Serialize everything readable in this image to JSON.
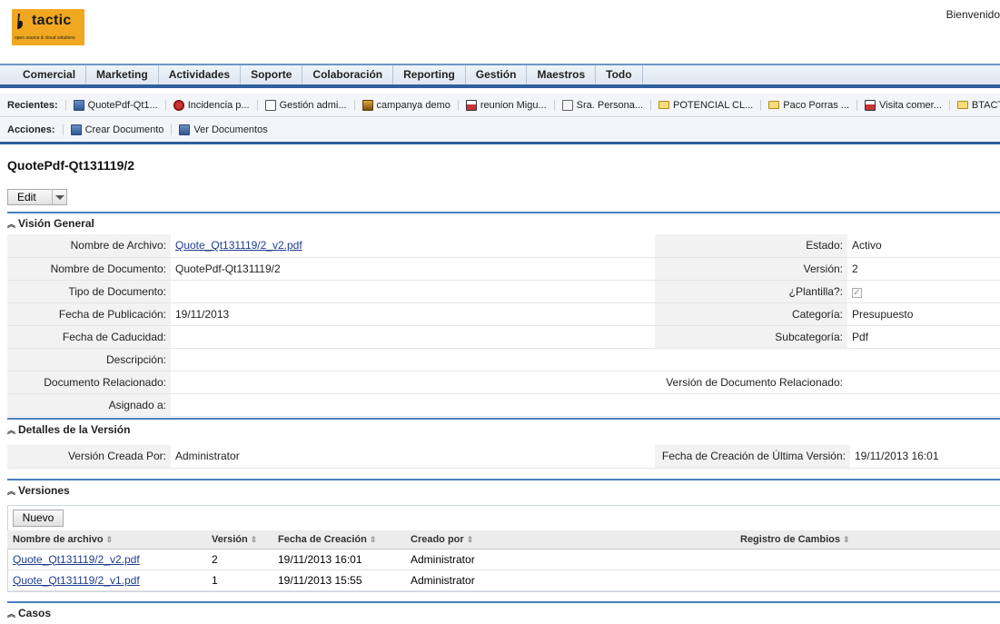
{
  "brand": {
    "name": "tactic",
    "tagline": "open source & cloud solutions",
    "accent": "#f0a820"
  },
  "header": {
    "welcome": "Bienvenido"
  },
  "nav": {
    "items": [
      "Comercial",
      "Marketing",
      "Actividades",
      "Soporte",
      "Colaboración",
      "Reporting",
      "Gestión",
      "Maestros",
      "Todo"
    ]
  },
  "recent": {
    "label": "Recientes:",
    "items": [
      {
        "label": "QuotePdf-Qt1...",
        "icon": "document-icon"
      },
      {
        "label": "Incidencia p...",
        "icon": "bug-icon"
      },
      {
        "label": "Gestión admi...",
        "icon": "list-icon"
      },
      {
        "label": "campanya demo",
        "icon": "campaign-icon"
      },
      {
        "label": "reunion Migu...",
        "icon": "calendar-icon"
      },
      {
        "label": "Sra. Persona...",
        "icon": "contact-card-icon"
      },
      {
        "label": "POTENCIAL CL...",
        "icon": "folder-icon"
      },
      {
        "label": "Paco Porras ...",
        "icon": "folder-icon"
      },
      {
        "label": "Visita comer...",
        "icon": "calendar-icon"
      },
      {
        "label": "BTACT",
        "icon": "folder-icon"
      }
    ]
  },
  "actions": {
    "label": "Acciones:",
    "items": [
      {
        "label": "Crear Documento",
        "icon": "create-document-icon"
      },
      {
        "label": "Ver Documentos",
        "icon": "view-documents-icon"
      }
    ]
  },
  "page": {
    "title": "QuotePdf-Qt131119/2",
    "edit_label": "Edit"
  },
  "overview": {
    "title": "Visión General",
    "left": [
      {
        "label": "Nombre de Archivo:",
        "value": "Quote_Qt131119/2_v2.pdf",
        "link": true
      },
      {
        "label": "Nombre de Documento:",
        "value": "QuotePdf-Qt131119/2"
      },
      {
        "label": "Tipo de Documento:",
        "value": ""
      },
      {
        "label": "Fecha de Publicación:",
        "value": "19/11/2013"
      },
      {
        "label": "Fecha de Caducidad:",
        "value": ""
      },
      {
        "label": "Descripción:",
        "value": ""
      },
      {
        "label": "Documento Relacionado:",
        "value": ""
      },
      {
        "label": "Asignado a:",
        "value": ""
      }
    ],
    "right": [
      {
        "label": "Estado:",
        "value": "Activo"
      },
      {
        "label": "Versión:",
        "value": "2"
      },
      {
        "label": "¿Plantilla?:",
        "value": "✓",
        "checkbox": true
      },
      {
        "label": "Categoría:",
        "value": "Presupuesto"
      },
      {
        "label": "Subcategoría:",
        "value": "Pdf"
      },
      {
        "label": "",
        "value": ""
      },
      {
        "label": "Versión de Documento Relacionado:",
        "value": ""
      },
      {
        "label": "",
        "value": ""
      }
    ]
  },
  "version_details": {
    "title": "Detalles de la Versión",
    "created_by_label": "Versión Creada Por:",
    "created_by_value": "Administrator",
    "last_date_label": "Fecha de Creación de Última Versión:",
    "last_date_value": "19/11/2013 16:01"
  },
  "versions": {
    "title": "Versiones",
    "new_label": "Nuevo",
    "columns": [
      "Nombre de archivo",
      "Versión",
      "Fecha de Creación",
      "Creado por",
      "Registro de Cambios"
    ],
    "rows": [
      [
        "Quote_Qt131119/2_v2.pdf",
        "2",
        "19/11/2013 16:01",
        "Administrator",
        ""
      ],
      [
        "Quote_Qt131119/2_v1.pdf",
        "1",
        "19/11/2013 15:55",
        "Administrator",
        ""
      ]
    ]
  },
  "cases": {
    "title": "Casos"
  }
}
